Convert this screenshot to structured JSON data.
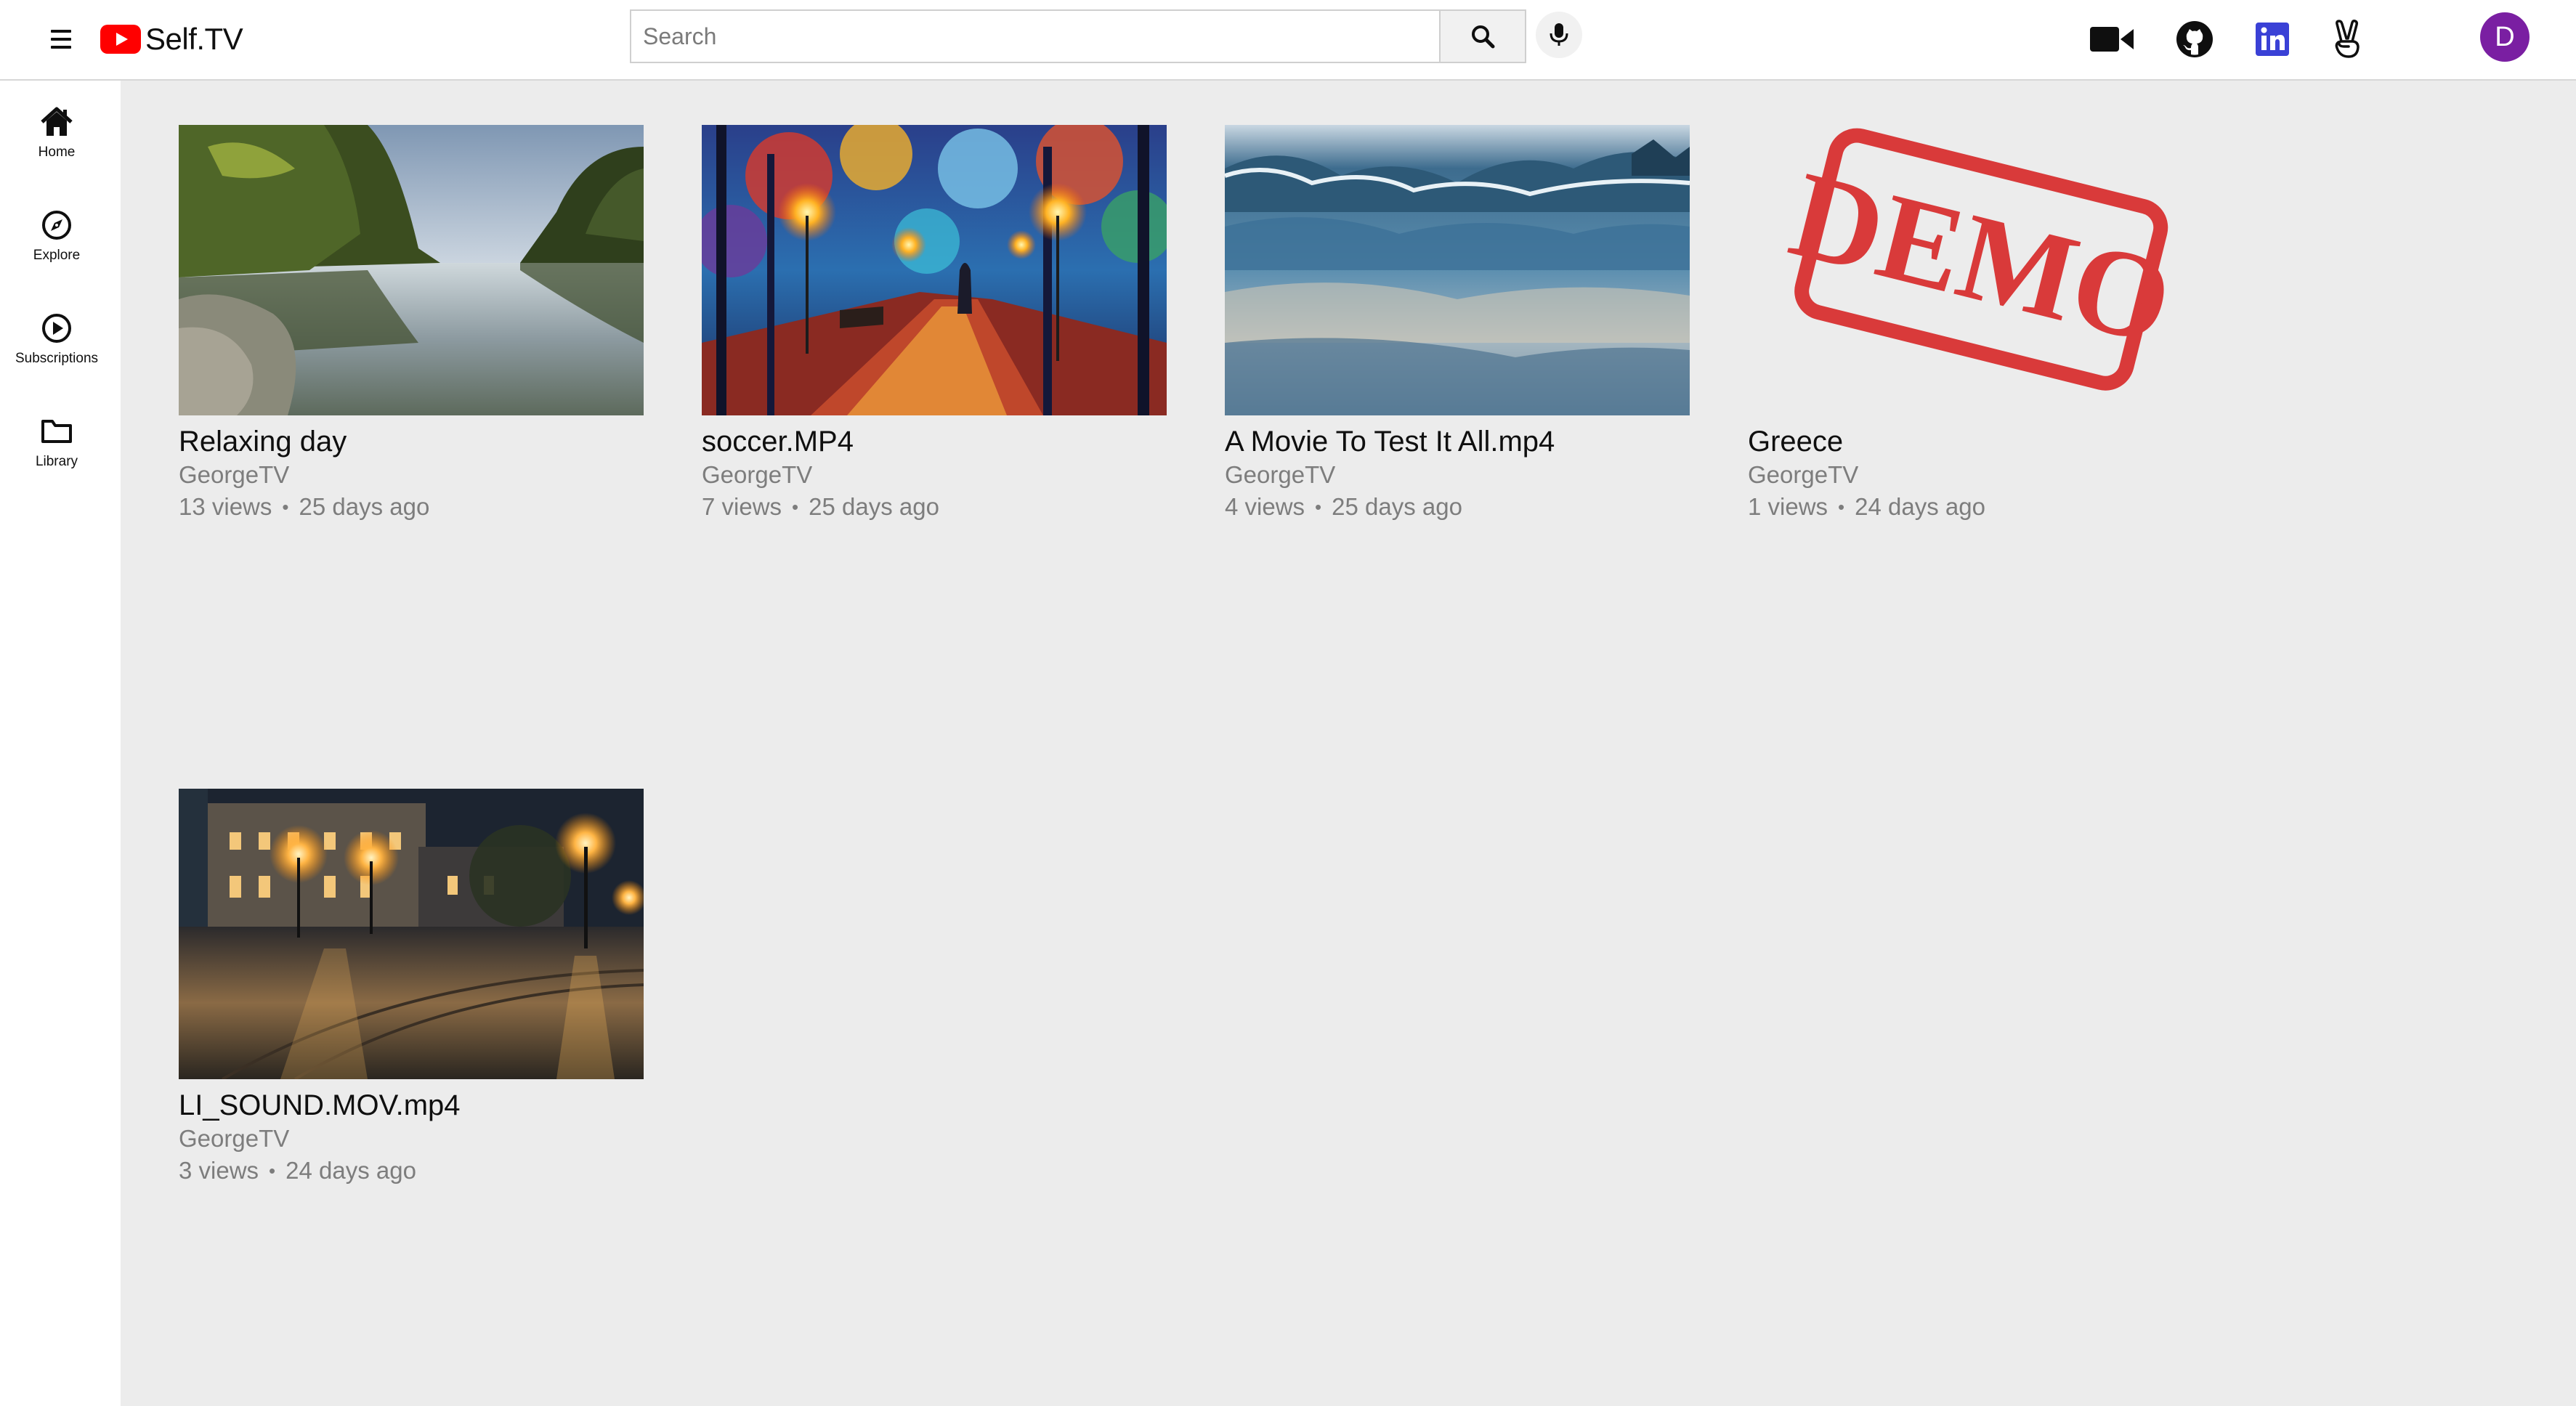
{
  "header": {
    "logo_text": "Self.TV",
    "search_placeholder": "Search",
    "search_value": "",
    "icons": [
      "menu-icon",
      "search-icon",
      "mic-icon",
      "video-camera-icon",
      "github-icon",
      "linkedin-icon",
      "angellist-icon"
    ],
    "avatar_initial": "D",
    "avatar_color": "#7a1fa2"
  },
  "sidebar": {
    "items": [
      {
        "label": "Home",
        "icon": "home-icon"
      },
      {
        "label": "Explore",
        "icon": "compass-icon"
      },
      {
        "label": "Subscriptions",
        "icon": "play-circle-icon"
      },
      {
        "label": "Library",
        "icon": "folder-icon"
      }
    ]
  },
  "videos": [
    {
      "title": "Relaxing day",
      "channel": "GeorgeTV",
      "views": "13 views",
      "age": "25 days ago"
    },
    {
      "title": "soccer.MP4",
      "channel": "GeorgeTV",
      "views": "7 views",
      "age": "25 days ago"
    },
    {
      "title": "A Movie To Test It All.mp4",
      "channel": "GeorgeTV",
      "views": "4 views",
      "age": "25 days ago"
    },
    {
      "title": "Greece",
      "channel": "GeorgeTV",
      "views": "1 views",
      "age": "24 days ago",
      "thumbnail_text": "DEMO"
    },
    {
      "title": "LI_SOUND.MOV.mp4",
      "channel": "GeorgeTV",
      "views": "3 views",
      "age": "24 days ago"
    }
  ],
  "colors": {
    "brand_red": "#ff0000",
    "page_bg": "#ececec",
    "meta_text": "#7d7d7d",
    "demo_stamp": "#d93a3a"
  }
}
